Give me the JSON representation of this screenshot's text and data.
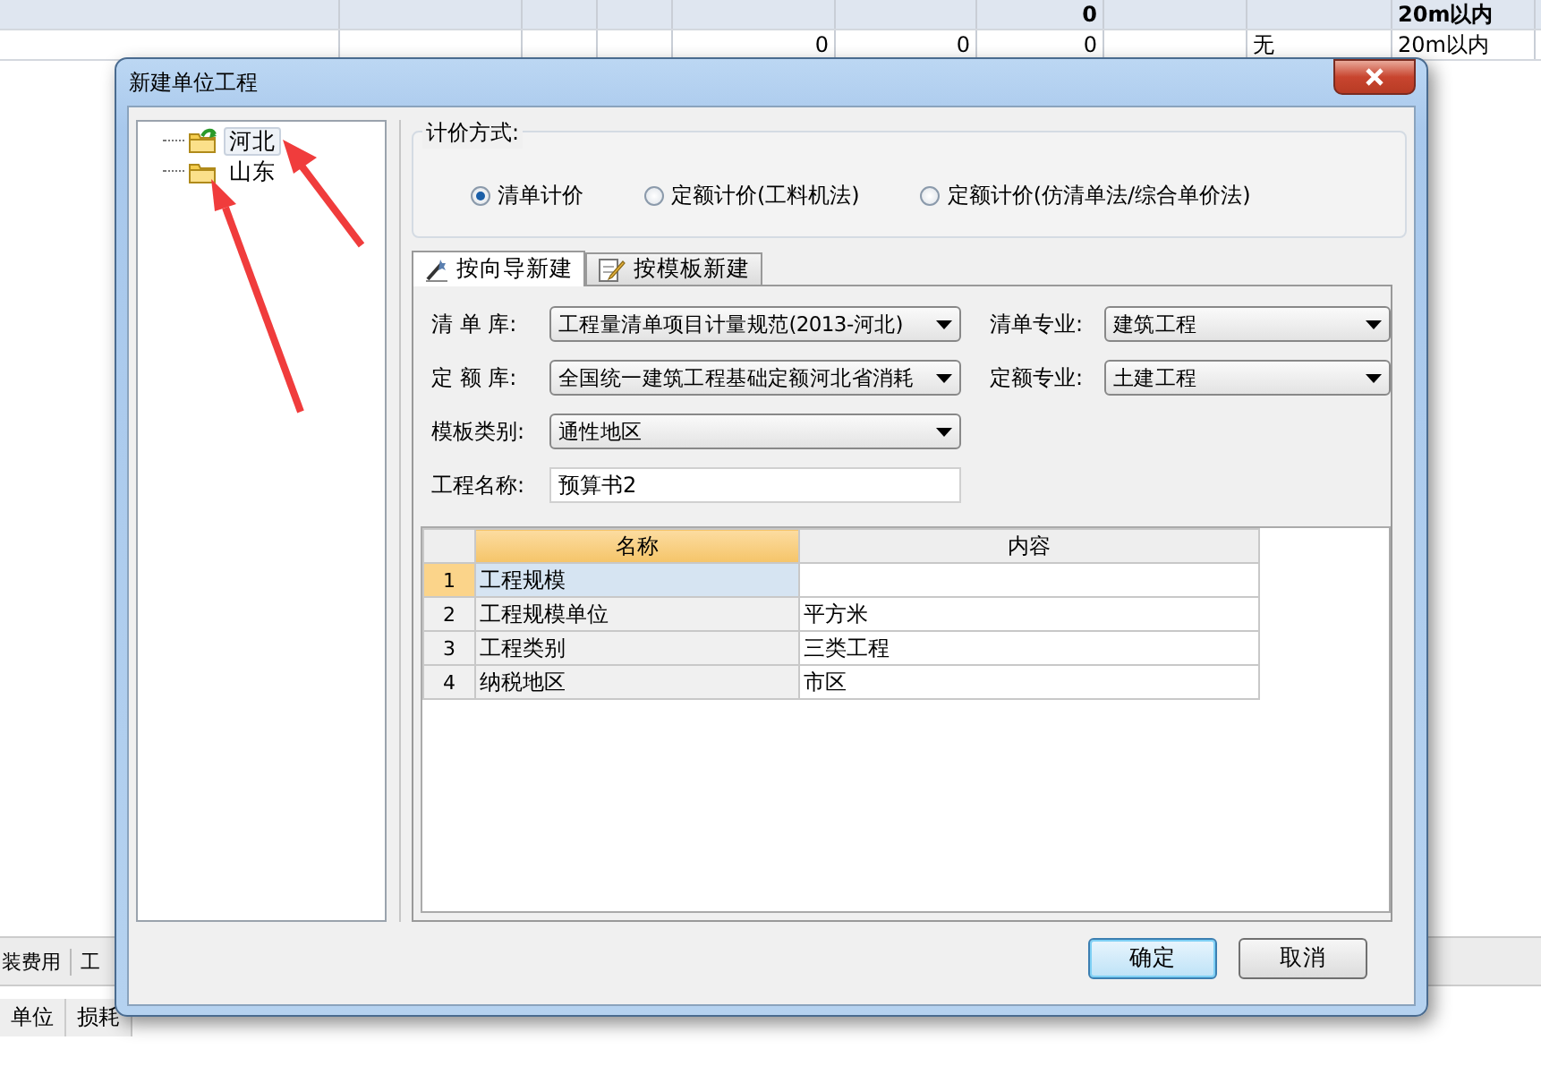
{
  "background_table": {
    "rows": [
      {
        "kind": "total",
        "column_7": "0",
        "column_10": "20m以内"
      },
      {
        "kind": "item",
        "column_5": "0",
        "column_6": "0",
        "column_7": "0",
        "column_9": "无",
        "column_10": "20m以内"
      }
    ]
  },
  "bottom_tabs": [
    "装费用",
    "工"
  ],
  "bottom_header": [
    "单位",
    "损耗"
  ],
  "dialog": {
    "title": "新建单位工程",
    "tree": [
      {
        "label": "河北",
        "selected": true,
        "kind": "current"
      },
      {
        "label": "山东",
        "selected": false,
        "kind": "folder"
      }
    ],
    "pricing": {
      "legend": "计价方式:",
      "options": [
        {
          "label": "清单计价",
          "selected": true
        },
        {
          "label": "定额计价(工料机法)",
          "selected": false
        },
        {
          "label": "定额计价(仿清单法/综合单价法)",
          "selected": false
        }
      ]
    },
    "tabs": [
      {
        "label": "按向导新建",
        "selected": true,
        "kind": "wizard"
      },
      {
        "label": "按模板新建",
        "selected": false,
        "kind": "template"
      }
    ],
    "form": [
      [
        {
          "label": "清 单 库:",
          "value": "工程量清单项目计量规范(2013-河北)",
          "kind": "select"
        },
        {
          "label": "清单专业:",
          "value": "建筑工程",
          "kind": "select"
        }
      ],
      [
        {
          "label": "定 额 库:",
          "value": "全国统一建筑工程基础定额河北省消耗",
          "kind": "select"
        },
        {
          "label": "定额专业:",
          "value": "土建工程",
          "kind": "select"
        }
      ],
      [
        {
          "label": "模板类别:",
          "value": "通性地区",
          "kind": "select"
        }
      ],
      [
        {
          "label": "工程名称:",
          "value": "预算书2",
          "kind": "text"
        }
      ]
    ],
    "grid": {
      "columns": [
        "名称",
        "内容"
      ],
      "rows": [
        {
          "number": "1",
          "name": "工程规模",
          "selected": true
        },
        {
          "number": "2",
          "name": "工程规模单位",
          "content": "平方米",
          "selected": false
        },
        {
          "number": "3",
          "name": "工程类别",
          "content": "三类工程",
          "selected": false
        },
        {
          "number": "4",
          "name": "纳税地区",
          "content": "市区",
          "selected": false
        }
      ]
    },
    "buttons": [
      {
        "label": "确定",
        "default": true
      },
      {
        "label": "取消",
        "default": false
      }
    ]
  }
}
